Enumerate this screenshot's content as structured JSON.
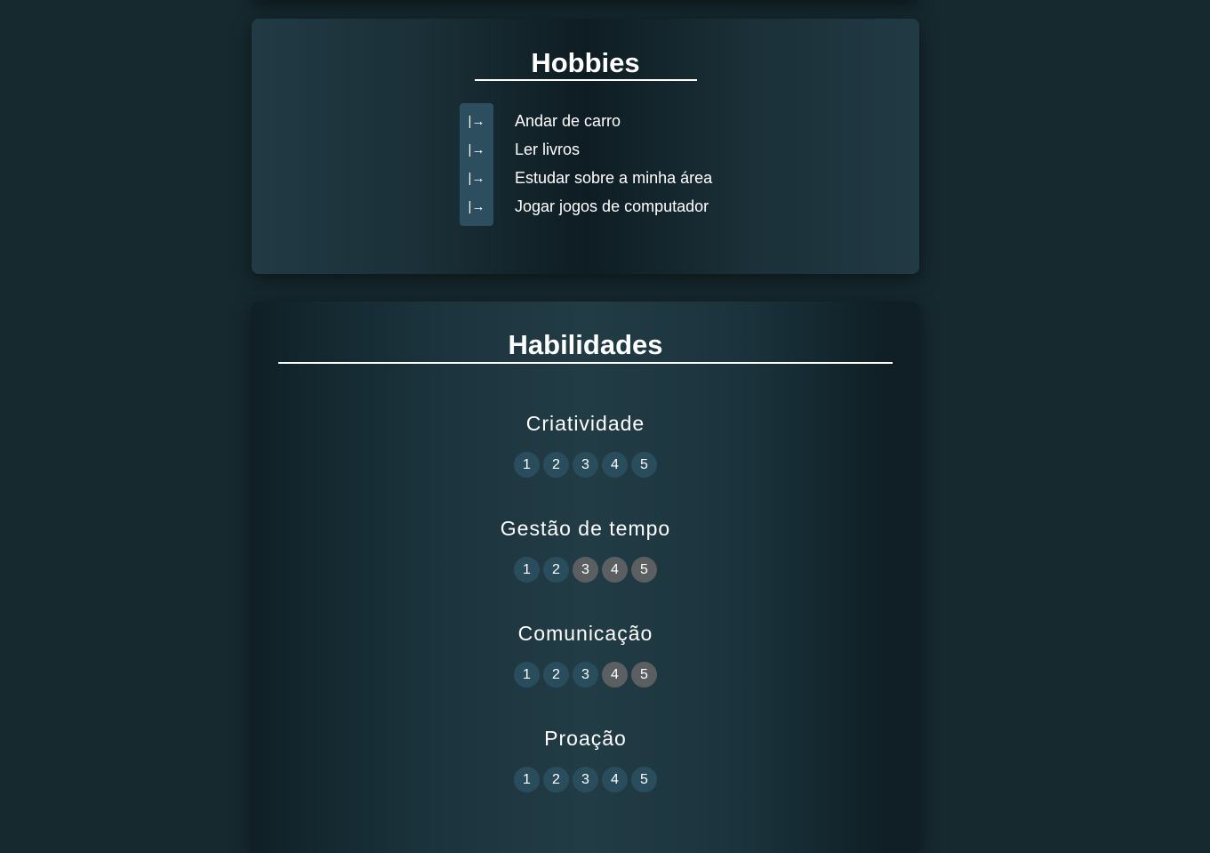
{
  "hobbies": {
    "title": "Hobbies",
    "icon": "arrow-right-to-bar-icon",
    "icon_glyph": "|→",
    "items": [
      "Andar de carro",
      "Ler livros",
      "Estudar sobre a minha área",
      "Jogar jogos de computador"
    ]
  },
  "skills": {
    "title": "Habilidades",
    "scale": [
      "1",
      "2",
      "3",
      "4",
      "5"
    ],
    "colors": {
      "active": "#2a4d5e",
      "inactive": "#5b5f62"
    },
    "items": [
      {
        "name": "Criatividade",
        "level": 5
      },
      {
        "name": "Gestão de tempo",
        "level": 2
      },
      {
        "name": "Comunicação",
        "level": 3
      },
      {
        "name": "Proação",
        "level": 5
      }
    ]
  }
}
